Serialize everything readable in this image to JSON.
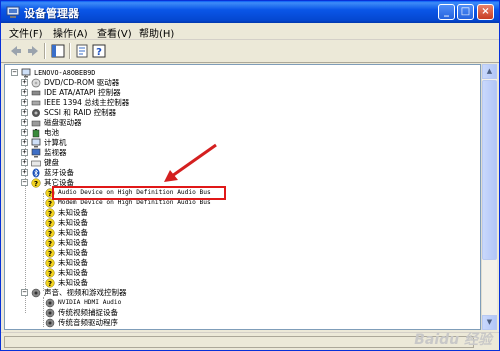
{
  "window": {
    "title": "设备管理器",
    "controls": {
      "minimize": "_",
      "maximize": "□",
      "close": "×"
    }
  },
  "menu": [
    {
      "label": "文件(F)"
    },
    {
      "label": "操作(A)"
    },
    {
      "label": "查看(V)"
    },
    {
      "label": "帮助(H)"
    }
  ],
  "toolbar": [
    "back-icon",
    "forward-icon",
    "show-hide-tree-icon",
    "properties-icon",
    "help-icon"
  ],
  "tree": {
    "root": "LENOVO-A8OBEB9D",
    "categories": [
      {
        "label": "DVD/CD-ROM 驱动器",
        "icon": "cdrom-icon",
        "expanded": false
      },
      {
        "label": "IDE ATA/ATAPI 控制器",
        "icon": "ide-controller-icon",
        "expanded": false
      },
      {
        "label": "IEEE 1394 总线主控制器",
        "icon": "ieee1394-icon",
        "expanded": false
      },
      {
        "label": "SCSI 和 RAID 控制器",
        "icon": "scsi-icon",
        "expanded": false
      },
      {
        "label": "磁盘驱动器",
        "icon": "disk-drive-icon",
        "expanded": false
      },
      {
        "label": "电池",
        "icon": "battery-icon",
        "expanded": false
      },
      {
        "label": "计算机",
        "icon": "computer-icon",
        "expanded": false
      },
      {
        "label": "监视器",
        "icon": "monitor-icon",
        "expanded": false
      },
      {
        "label": "键盘",
        "icon": "keyboard-icon",
        "expanded": false
      },
      {
        "label": "蓝牙设备",
        "icon": "bluetooth-icon",
        "expanded": false
      },
      {
        "label": "其它设备",
        "icon": "other-devices-icon",
        "expanded": true
      }
    ],
    "other_devices": [
      "Audio Device on High Definition Audio Bus",
      "Modem Device on High Definition Audio Bus",
      "未知设备",
      "未知设备",
      "未知设备",
      "未知设备",
      "未知设备",
      "未知设备",
      "未知设备",
      "未知设备"
    ],
    "sound_category": "声音、视频和游戏控制器",
    "sound_devices": [
      "NVIDIA HDMI Audio",
      "传统视频捕捉设备",
      "传统音频驱动程序"
    ]
  },
  "annotation": {
    "highlight_color": "#e01818",
    "arrow_color": "#d42020"
  },
  "watermark": "Baidu 经验"
}
